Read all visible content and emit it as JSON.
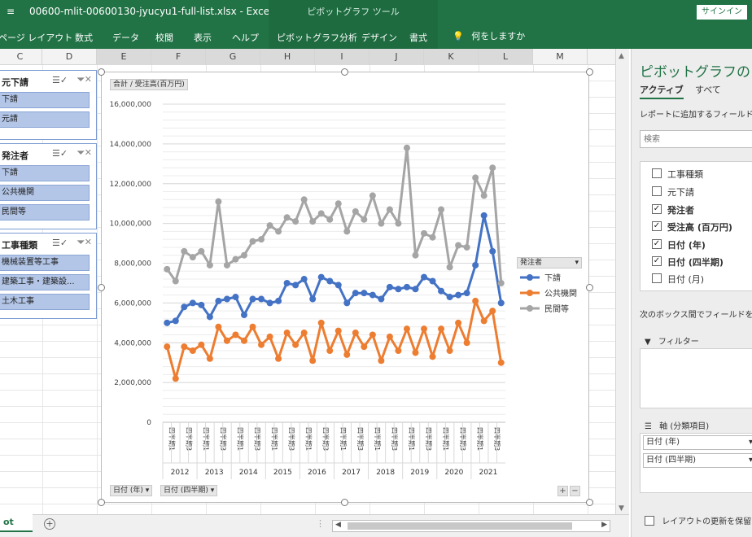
{
  "titlebar": {
    "quick_access": "\u0002",
    "document": "00600-mlit-00600130-jyucyu1-full-list.xlsx  -  Excel",
    "context_title": "ピボットグラフ ツール",
    "signin": "サインイン"
  },
  "ribbon": {
    "tabs": [
      "ページ レイアウト",
      "数式",
      "データ",
      "校閲",
      "表示",
      "ヘルプ",
      "ピボットグラフ分析",
      "デザイン",
      "書式"
    ],
    "tell_me": "何をしますか"
  },
  "columns": [
    "C",
    "D",
    "E",
    "F",
    "G",
    "H",
    "I",
    "J",
    "K",
    "L",
    "M"
  ],
  "slicers": [
    {
      "title": "元下請",
      "items": [
        "下請",
        "元請"
      ]
    },
    {
      "title": "発注者",
      "items": [
        "下請",
        "公共機関",
        "民間等"
      ]
    },
    {
      "title": "工事種類",
      "items": [
        "機械装置等工事",
        "建築工事・建築設...",
        "土木工事"
      ]
    }
  ],
  "chart": {
    "value_field_button": "合計 / 受注高(百万円)",
    "legend_field_button": "発注者",
    "axis_field_buttons": [
      "日付 (年)",
      "日付 (四半期)"
    ],
    "plus": "+",
    "minus": "−"
  },
  "chart_data": {
    "type": "line",
    "title": "",
    "ylabel": "",
    "xlabel": "",
    "ylim": [
      0,
      16000000
    ],
    "yticks": [
      "0",
      "2,000,000",
      "4,000,000",
      "6,000,000",
      "8,000,000",
      "10,000,000",
      "12,000,000",
      "14,000,000",
      "16,000,000"
    ],
    "years": [
      "2012",
      "2013",
      "2014",
      "2015",
      "2016",
      "2017",
      "2018",
      "2019",
      "2020",
      "2021"
    ],
    "quarter_labels": [
      "四半期1",
      "四半期2",
      "四半期3",
      "四半期4"
    ],
    "legend_position": "right",
    "grid": true,
    "series": [
      {
        "name": "下請",
        "color": "#4472C4",
        "values": [
          5000000,
          5100000,
          5800000,
          6000000,
          5900000,
          5300000,
          6100000,
          6200000,
          6300000,
          5400000,
          6200000,
          6200000,
          6000000,
          6100000,
          7000000,
          6900000,
          7200000,
          6200000,
          7300000,
          7100000,
          6900000,
          6000000,
          6500000,
          6500000,
          6400000,
          6200000,
          6800000,
          6700000,
          6800000,
          6700000,
          7300000,
          7100000,
          6600000,
          6300000,
          6400000,
          6500000,
          7900000,
          10400000,
          8600000,
          6000000
        ]
      },
      {
        "name": "公共機関",
        "color": "#ED7D31",
        "values": [
          3800000,
          2200000,
          3800000,
          3600000,
          3900000,
          3200000,
          4800000,
          4100000,
          4400000,
          4100000,
          4800000,
          3900000,
          4300000,
          3200000,
          4500000,
          3900000,
          4500000,
          3100000,
          5000000,
          3600000,
          4600000,
          3400000,
          4500000,
          3800000,
          4400000,
          3100000,
          4300000,
          3600000,
          4700000,
          3500000,
          4700000,
          3300000,
          4700000,
          3600000,
          5000000,
          4000000,
          6100000,
          5100000,
          5600000,
          3000000
        ]
      },
      {
        "name": "民間等",
        "color": "#A5A5A5",
        "values": [
          7700000,
          7100000,
          8600000,
          8300000,
          8600000,
          7900000,
          11100000,
          7900000,
          8200000,
          8400000,
          9100000,
          9200000,
          9900000,
          9600000,
          10300000,
          10100000,
          11200000,
          10100000,
          10500000,
          10200000,
          11000000,
          9600000,
          10600000,
          10200000,
          11400000,
          10000000,
          10700000,
          10000000,
          13800000,
          8400000,
          9500000,
          9300000,
          10700000,
          7800000,
          8900000,
          8800000,
          12300000,
          11400000,
          12800000,
          7000000
        ]
      }
    ]
  },
  "sheet": {
    "tab_label": "ot",
    "add": "+",
    "dots": "⋮"
  },
  "pane": {
    "title": "ピボットグラフのフィ",
    "tab_active": "アクティブ",
    "tab_all": "すべて",
    "subtitle": "レポートに追加するフィールドを選",
    "search_placeholder": "検索",
    "fields": [
      {
        "label": "工事種類",
        "checked": false
      },
      {
        "label": "元下請",
        "checked": false
      },
      {
        "label": "発注者",
        "checked": true
      },
      {
        "label": "受注高 (百万円)",
        "checked": true
      },
      {
        "label": "日付 (年)",
        "checked": true
      },
      {
        "label": "日付 (四半期)",
        "checked": true
      },
      {
        "label": "日付 (月)",
        "checked": false
      }
    ],
    "drag_hint": "次のボックス間でフィールドをドラ",
    "filter_label": "フィルター",
    "axis_label": "軸 (分類項目)",
    "axis_items": [
      "日付 (年)",
      "日付 (四半期)"
    ],
    "defer_label": "レイアウトの更新を保留する"
  }
}
